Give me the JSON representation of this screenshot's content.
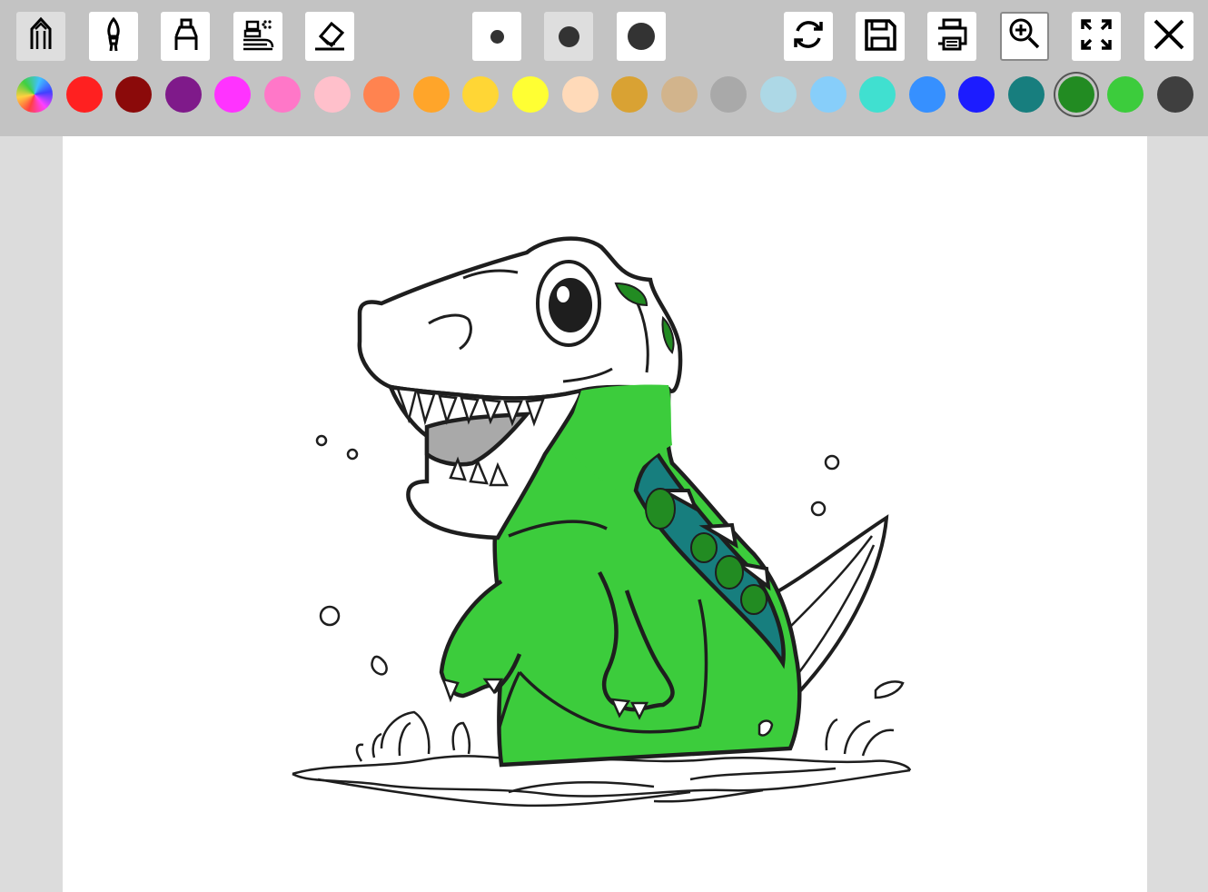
{
  "toolbar": {
    "tools": [
      {
        "name": "pencil",
        "icon": "pencil-icon"
      },
      {
        "name": "brush",
        "icon": "brush-icon"
      },
      {
        "name": "marker",
        "icon": "marker-icon"
      },
      {
        "name": "spray",
        "icon": "spray-icon"
      },
      {
        "name": "eraser",
        "icon": "eraser-icon"
      }
    ],
    "sizes": [
      "small",
      "medium",
      "large"
    ],
    "selected_size": "medium",
    "actions": [
      {
        "name": "reset",
        "icon": "refresh-icon"
      },
      {
        "name": "save",
        "icon": "save-icon"
      },
      {
        "name": "print",
        "icon": "print-icon"
      },
      {
        "name": "zoom",
        "icon": "zoom-in-icon"
      },
      {
        "name": "fullscreen",
        "icon": "fullscreen-icon"
      },
      {
        "name": "close",
        "icon": "close-icon"
      }
    ]
  },
  "palette": {
    "selected": "#228b22",
    "colors": [
      "rainbow",
      "#ff2020",
      "#8b0a0a",
      "#7f1a8a",
      "#ff33ff",
      "#ff77c8",
      "#ffc0cb",
      "#ff8350",
      "#ffa52a",
      "#ffd635",
      "#ffff33",
      "#ffdab9",
      "#d9a233",
      "#d2b48c",
      "#a9a9a9",
      "#add8e6",
      "#87cefa",
      "#40e0d0",
      "#3690ff",
      "#1c1cff",
      "#177e7e",
      "#228b22",
      "#3ccc3c",
      "#3f3f3f"
    ]
  },
  "artwork": {
    "subject": "dinosaur-coloring-page",
    "fill_colors": {
      "body": "#3ccc3c",
      "back": "#177e7e",
      "spots": "#228b22",
      "mouth": "#a9a9a9"
    }
  }
}
